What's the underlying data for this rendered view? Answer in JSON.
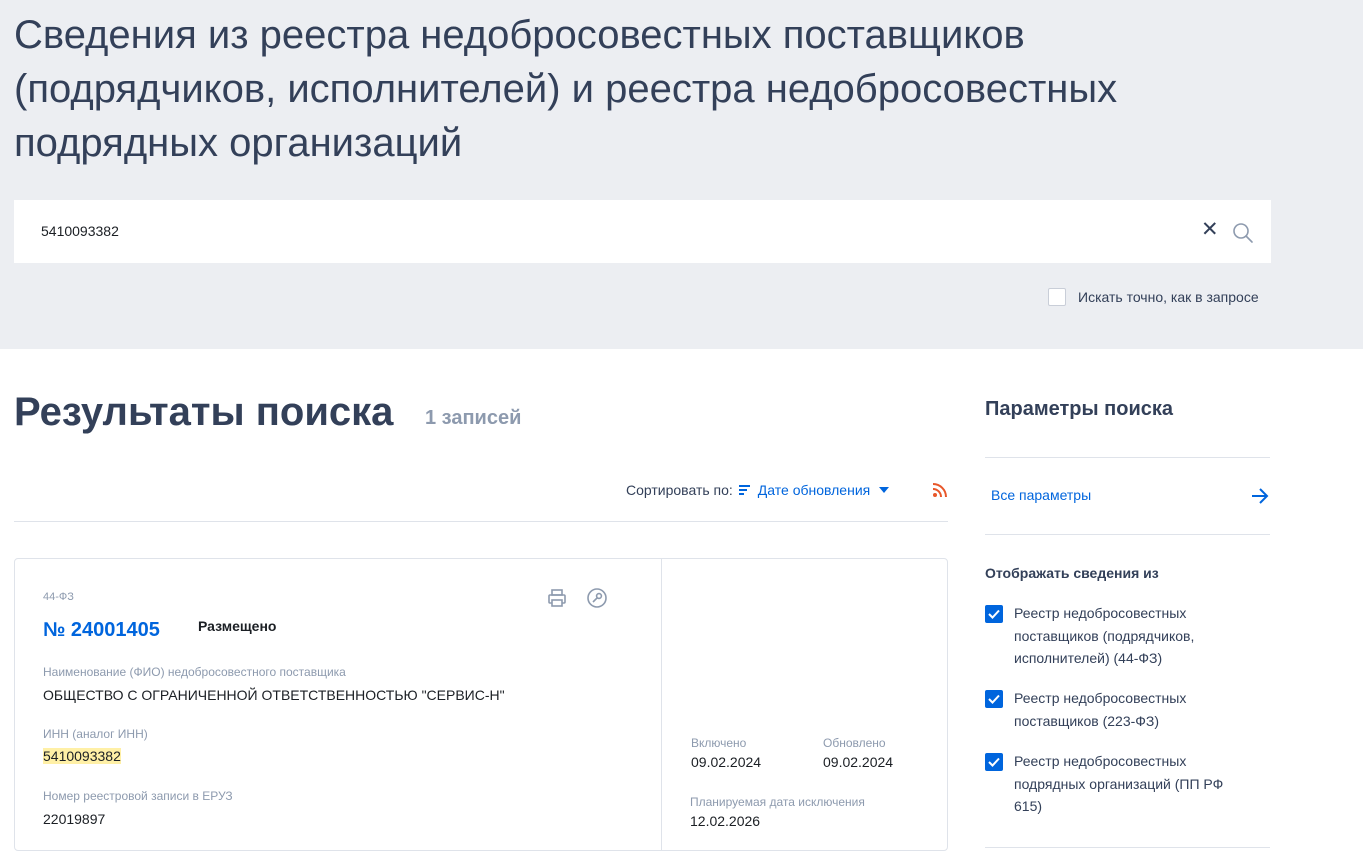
{
  "header": {
    "title": "Сведения из реестра недобросовестных поставщиков (подрядчиков, исполнителей) и реестра недобросовестных подрядных организаций"
  },
  "search": {
    "value": "5410093382",
    "clear_icon": "close-icon",
    "search_icon": "magnifier-icon",
    "exact_label": "Искать точно, как в запросе",
    "exact_checked": false
  },
  "results": {
    "title": "Результаты поиска",
    "count": "1 записей",
    "sort_label": "Сортировать по:",
    "sort_value": "Дате обновления"
  },
  "card": {
    "law": "44-ФЗ",
    "number": "№ 24001405",
    "status": "Размещено",
    "name_label": "Наименование (ФИО) недобросовестного поставщика",
    "name_value": "ОБЩЕСТВО С ОГРАНИЧЕННОЙ ОТВЕТСТВЕННОСТЬЮ \"СЕРВИС-Н\"",
    "inn_label": "ИНН (аналог ИНН)",
    "inn_value": "5410093382",
    "eruz_label": "Номер реестровой записи в ЕРУЗ",
    "eruz_value": "22019897",
    "included_label": "Включено",
    "included_value": "09.02.2024",
    "updated_label": "Обновлено",
    "updated_value": "09.02.2024",
    "exclusion_label": "Планируемая дата исключения",
    "exclusion_value": "12.02.2026"
  },
  "sidebar": {
    "title": "Параметры поиска",
    "all_params": "Все параметры",
    "show_from": "Отображать сведения из",
    "registers": [
      {
        "label": "Реестр недобросовестных поставщиков (подрядчиков, исполнителей) (44-ФЗ)",
        "checked": true
      },
      {
        "label": "Реестр недобросовестных поставщиков (223-ФЗ)",
        "checked": true
      },
      {
        "label": "Реестр недобросовестных подрядных организаций (ПП РФ 615)",
        "checked": true
      }
    ]
  },
  "colors": {
    "accent": "#0065dd",
    "text": "#334059",
    "muted": "#8d9aae",
    "header_bg": "#eceef2",
    "highlight": "#fff0a6",
    "rss": "#e8572a"
  }
}
